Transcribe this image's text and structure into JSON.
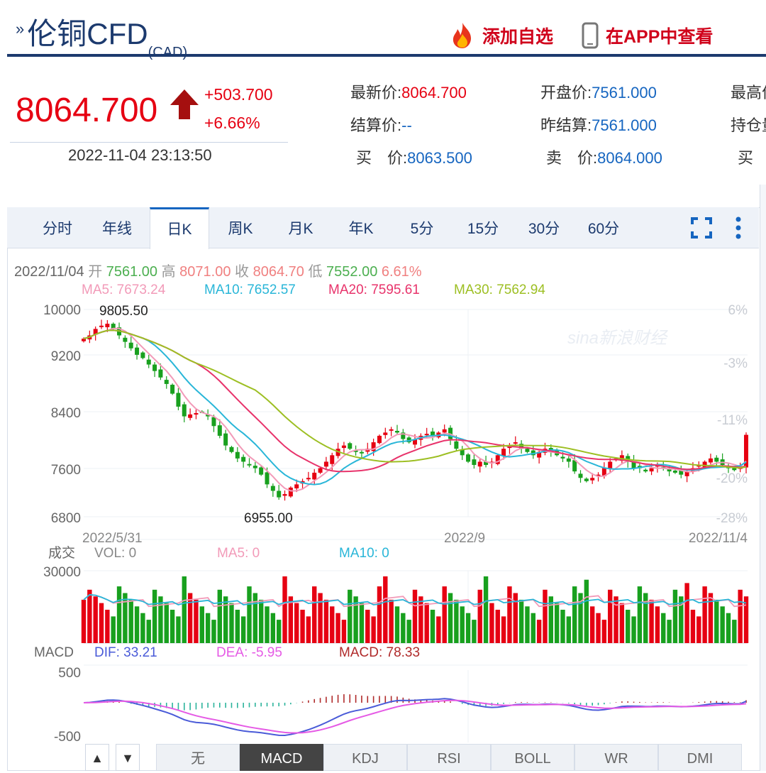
{
  "header": {
    "title": "伦铜CFD",
    "title_sub": "(CAD)",
    "add_watch": "添加自选",
    "view_app": "在APP中查看"
  },
  "quote": {
    "price": "8064.700",
    "change": "+503.700",
    "change_pct": "+6.66%",
    "time": "2022-11-04 23:13:50",
    "fields": [
      {
        "label": "最新价:",
        "value": "8064.700",
        "red": true
      },
      {
        "label": "开盘价:",
        "value": "7561.000"
      },
      {
        "label": "最高价",
        "value": ""
      },
      {
        "label": "结算价:",
        "value": "--"
      },
      {
        "label": "昨结算:",
        "value": "7561.000"
      },
      {
        "label": "持仓量",
        "value": ""
      },
      {
        "label": "买　价:",
        "value": "8063.500"
      },
      {
        "label": "卖　价:",
        "value": "8064.000"
      },
      {
        "label": "买　量",
        "value": ""
      }
    ]
  },
  "tabs": [
    "分时",
    "年线",
    "日K",
    "周K",
    "月K",
    "年K",
    "5分",
    "15分",
    "30分",
    "60分"
  ],
  "active_tab": "日K",
  "info_bar": {
    "date": "2022/11/04",
    "open_label": "开",
    "open": "7561.00",
    "high_label": "高",
    "high": "8071.00",
    "close_label": "收",
    "close": "8064.70",
    "low_label": "低",
    "low": "7552.00",
    "pct": "6.61%"
  },
  "ma_legend": {
    "ma5": "MA5: 7673.24",
    "ma10": "MA10: 7652.57",
    "ma20": "MA20: 7595.61",
    "ma30": "MA30: 7562.94"
  },
  "price_axis": {
    "left_ticks": [
      "10000",
      "9200",
      "8400",
      "7600",
      "6800"
    ],
    "right_ticks": [
      "6%",
      "-3%",
      "-11%",
      "-20%",
      "-28%"
    ],
    "max_label": "9805.50",
    "min_label": "6955.00",
    "date_ticks": [
      "2022/5/31",
      "2022/9",
      "2022/11/4"
    ],
    "watermark": "sina新浪财经"
  },
  "volume": {
    "title": "成交",
    "vol": "VOL: 0",
    "ma5": "MA5: 0",
    "ma10": "MA10: 0",
    "top_tick": "30000"
  },
  "macd": {
    "title": "MACD",
    "dif": "DIF: 33.21",
    "dea": "DEA: -5.95",
    "macd": "MACD: 78.33",
    "top_tick": "500",
    "bottom_tick": "-500"
  },
  "bottom_tabs": [
    "无",
    "MACD",
    "KDJ",
    "RSI",
    "BOLL",
    "WR",
    "DMI"
  ],
  "bottom_active": "MACD",
  "nav_buttons": [
    "▲",
    "▼"
  ],
  "colors": {
    "up": "#e60012",
    "down": "#18a01e",
    "brand": "#1c3a6e",
    "ma5": "#f29ab8",
    "ma10": "#29b6d8",
    "ma20": "#e8336b",
    "ma30": "#9dbf23",
    "dif": "#4a5bd8",
    "dea": "#e55ae5"
  },
  "chart_data": {
    "type": "candlestick",
    "x_range": [
      "2022/5/31",
      "2022/11/4"
    ],
    "ylim": [
      6800,
      10000
    ],
    "last_candle": {
      "date": "2022/11/04",
      "open": 7561.0,
      "high": 8071.0,
      "low": 7552.0,
      "close": 8064.7
    },
    "period_high": 9805.5,
    "period_low": 6955.0,
    "close_path": [
      9550,
      9600,
      9700,
      9750,
      9780,
      9700,
      9600,
      9500,
      9400,
      9300,
      9250,
      9150,
      9050,
      8950,
      8850,
      8700,
      8500,
      8350,
      8380,
      8400,
      8420,
      8350,
      8200,
      8050,
      7900,
      7800,
      7700,
      7650,
      7600,
      7550,
      7450,
      7300,
      7200,
      7100,
      7150,
      7250,
      7300,
      7350,
      7400,
      7480,
      7550,
      7650,
      7750,
      7850,
      7900,
      7850,
      7800,
      7780,
      7850,
      7950,
      8050,
      8100,
      8150,
      8100,
      8000,
      7950,
      8000,
      8050,
      8080,
      8050,
      8100,
      8150,
      8000,
      7850,
      7750,
      7650,
      7600,
      7650,
      7600,
      7650,
      7750,
      7850,
      7900,
      7950,
      7850,
      7800,
      7750,
      7800,
      7850,
      7800,
      7750,
      7700,
      7650,
      7500,
      7400,
      7350,
      7400,
      7450,
      7550,
      7650,
      7700,
      7750,
      7650,
      7550,
      7550,
      7500,
      7550,
      7600,
      7550,
      7500,
      7480,
      7450,
      7500,
      7550,
      7600,
      7650,
      7700,
      7650,
      7600,
      7550,
      7520,
      7561,
      8064.7
    ],
    "series": [
      {
        "name": "MA5",
        "final": 7673.24
      },
      {
        "name": "MA10",
        "final": 7652.57
      },
      {
        "name": "MA20",
        "final": 7595.61
      },
      {
        "name": "MA30",
        "final": 7562.94
      }
    ],
    "volume_ylim": [
      0,
      30000
    ],
    "macd_ylim": [
      -500,
      500
    ],
    "macd_last": {
      "DIF": 33.21,
      "DEA": -5.95,
      "MACD": 78.33
    }
  }
}
